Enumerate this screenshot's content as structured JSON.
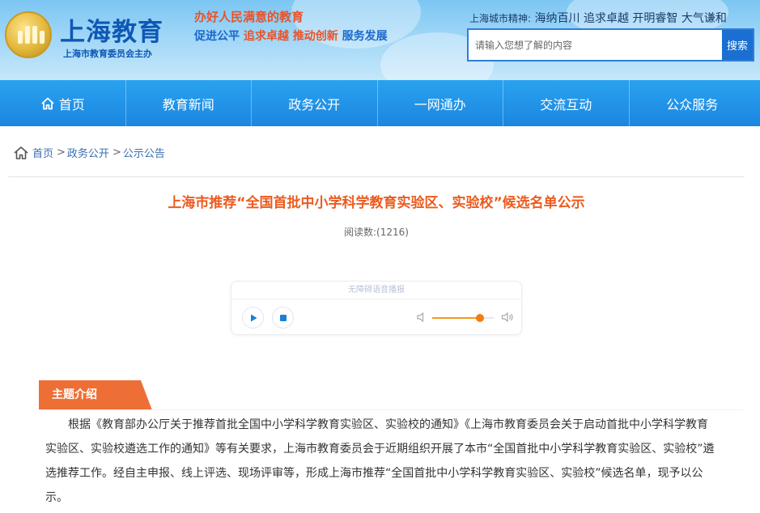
{
  "header": {
    "logo_title": "上海教育",
    "logo_sub": "上海市教育委员会主办",
    "slogan_line1": "办好人民满意的教育",
    "slogan_line2_parts": [
      "促进公平",
      "追求卓越",
      "推动创新",
      "服务发展"
    ],
    "city_spirit_label": "上海城市精神:",
    "city_spirit_text": "海纳百川 追求卓越 开明睿智 大气谦和",
    "search": {
      "placeholder": "请输入您想了解的内容",
      "button_label": "搜索"
    }
  },
  "nav": {
    "items": [
      {
        "label": "首页",
        "icon": "home-icon"
      },
      {
        "label": "教育新闻"
      },
      {
        "label": "政务公开"
      },
      {
        "label": "一网通办"
      },
      {
        "label": "交流互动"
      },
      {
        "label": "公众服务"
      }
    ]
  },
  "breadcrumb": {
    "icon": "home-icon",
    "items": [
      "首页",
      "政务公开",
      "公示公告"
    ],
    "separator": ">"
  },
  "article": {
    "title": "上海市推荐“全国首批中小学科学教育实验区、实验校”候选名单公示",
    "read_count": "阅读数:(1216)"
  },
  "audio_player": {
    "label": "无障碍语音播报",
    "play_icon": "play-icon",
    "stop_icon": "stop-icon",
    "volume_level": 0.78,
    "accent_color": "#f07d12"
  },
  "section": {
    "tab_label": "主题介绍",
    "body": "根据《教育部办公厅关于推荐首批全国中小学科学教育实验区、实验校的通知》《上海市教育委员会关于启动首批中小学科学教育实验区、实验校遴选工作的通知》等有关要求，上海市教育委员会于近期组织开展了本市“全国首批中小学科学教育实验区、实验校”遴选推荐工作。经自主申报、线上评选、现场评审等，形成上海市推荐“全国首批中小学科学教育实验区、实验校”候选名单，现予以公示。"
  },
  "colors": {
    "nav_blue": "#1b86e0",
    "title_orange": "#ec5b1f",
    "tab_orange": "#ee6f35",
    "link_blue": "#3a6fb0"
  }
}
